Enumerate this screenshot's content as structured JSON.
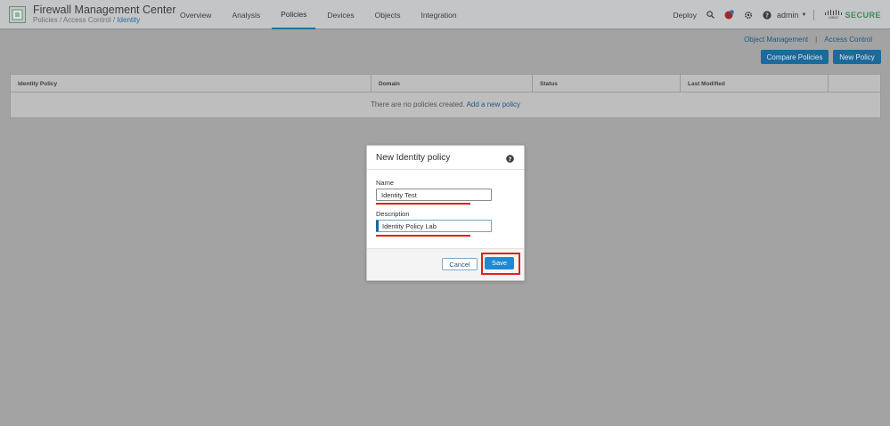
{
  "header": {
    "app_title": "Firewall Management Center",
    "breadcrumb": [
      "Policies",
      "Access Control",
      "Identity"
    ],
    "breadcrumb_separator": "/",
    "nav": [
      "Overview",
      "Analysis",
      "Policies",
      "Devices",
      "Objects",
      "Integration"
    ],
    "active_nav": "Policies",
    "deploy_label": "Deploy",
    "user_label": "admin",
    "brand_small": "cisco",
    "brand_secure": "SECURE",
    "icons": [
      "search-icon",
      "alert-icon",
      "gear-icon",
      "help-icon",
      "chevron-down-icon"
    ]
  },
  "links": {
    "object_management": "Object Management",
    "separator": "|",
    "access_control": "Access Control"
  },
  "buttons": {
    "compare_policies": "Compare Policies",
    "new_policy": "New Policy"
  },
  "table": {
    "columns": [
      "Identity Policy",
      "Domain",
      "Status",
      "Last Modified",
      ""
    ],
    "empty_text": "There are no policies created.",
    "empty_link": "Add a new policy"
  },
  "dialog": {
    "title": "New Identity policy",
    "name_label": "Name",
    "name_value": "Identity Test",
    "description_label": "Description",
    "description_value": "Identity Policy Lab",
    "cancel_label": "Cancel",
    "save_label": "Save"
  },
  "colors": {
    "accent": "#1a6a9c",
    "annotation_red": "#e0201a",
    "secure_green": "#3f8a5a"
  }
}
